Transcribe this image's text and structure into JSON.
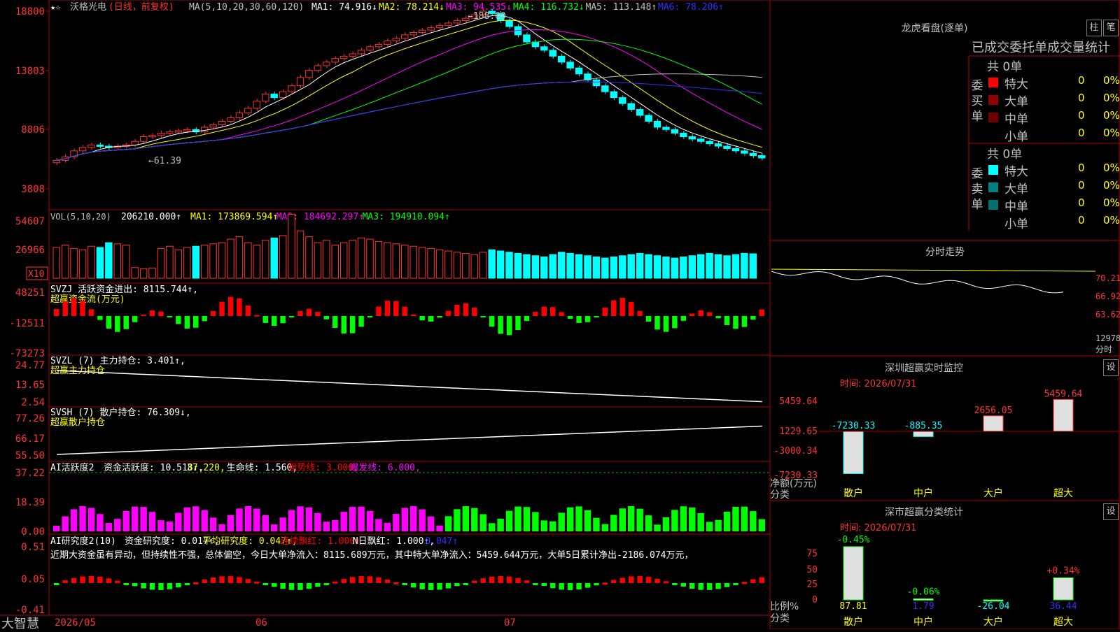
{
  "stock": {
    "name": "沃格光电",
    "period": "(日线，前复权)",
    "brand": "大智慧"
  },
  "colors": {
    "up": "#ff3232",
    "down": "#00ffff",
    "buy": "#ff0000",
    "sell": "#00ff00",
    "grid": "#b00000"
  },
  "price_panel": {
    "ma_header": "MA(5,10,20,30,60,120)",
    "ma_values": [
      {
        "label": "MA1: 74.916↓",
        "color": "#ffffff"
      },
      {
        "label": "MA2: 78.214↓",
        "color": "#ffff00"
      },
      {
        "label": "MA3: 94.535↓",
        "color": "#ff00ff"
      },
      {
        "label": "MA4: 116.732↓",
        "color": "#00ff00"
      },
      {
        "label": "MA5: 113.148↑",
        "color": "#c0c0c0"
      },
      {
        "label": "MA6: 78.206↑",
        "color": "#3030ff"
      }
    ],
    "yticks": [
      "18800",
      "13803",
      "8806",
      "3808"
    ],
    "high_label": "188.00",
    "low_label": "61.39"
  },
  "volume_panel": {
    "header": "VOL(5,10,20)",
    "value": "206210.000↑",
    "ma": [
      {
        "label": "MA1: 173869.594↑",
        "color": "#ffff00"
      },
      {
        "label": "MA2: 184692.297↑",
        "color": "#ff00ff"
      },
      {
        "label": "MA3: 194910.094↑",
        "color": "#00ff00"
      }
    ],
    "yticks": [
      "54607",
      "26966"
    ],
    "unit": "X10"
  },
  "svzj_panel": {
    "header": "SVZJ",
    "label": "活跃资金进出: 8115.744↑,",
    "sub": "超赢资金流(万元)",
    "yticks": [
      "48251",
      "-12511",
      "-73273"
    ]
  },
  "svzl_panel": {
    "header": "SVZL (7)",
    "label": "主力持仓: 3.401↑,",
    "sub": "超赢主力持仓",
    "yticks": [
      "24.77",
      "13.65",
      "2.54"
    ]
  },
  "svsh_panel": {
    "header": "SVSH (7)",
    "label": "散户持仓: 76.309↓,",
    "sub": "超赢散户持仓",
    "yticks": [
      "77.26",
      "66.17",
      "55.50"
    ]
  },
  "ai_active_panel": {
    "header": "AI活跃度2",
    "items": [
      {
        "label": "资金活跃度: 10.518↑,",
        "color": "#ffffff"
      },
      {
        "label": "37.220,",
        "color": "#ffff00"
      },
      {
        "label": "生命线: 1.560,",
        "color": "#ffffff"
      },
      {
        "label": "强势线: 3.000,",
        "color": "#ff0000"
      },
      {
        "label": "爆发线: 6.000,",
        "color": "#ff00ff"
      }
    ],
    "yticks": [
      "37.22",
      "18.39",
      "0.00"
    ]
  },
  "ai_research_panel": {
    "header": "AI研究度2(10)",
    "items": [
      {
        "label": "资金研究度: 0.017↑,",
        "color": "#ffffff"
      },
      {
        "label": "平均研究度: 0.047↑,",
        "color": "#ffff00"
      },
      {
        "label": "连续飘红: 1.000↑,",
        "color": "#ff0000"
      },
      {
        "label": "N日飘红: 1.000↑,",
        "color": "#ffffff"
      },
      {
        "label": "0.047↑",
        "color": "#3030ff"
      }
    ],
    "comment": "近期大资金虽有异动，但持续性不强，总体偏空，今日大单净流入：8115.689万元，其中特大单净流入：5459.644万元，大单5日累计净出-2186.074万元，",
    "yticks": [
      "0.51",
      "0.05",
      "-0.41"
    ]
  },
  "date_axis": {
    "labels": [
      "2026/05",
      "06",
      "07"
    ]
  },
  "longhu": {
    "title": "龙虎看盘(逐单)",
    "tab1": "柱",
    "tab2": "笔",
    "subtitle": "已成交委托单成交量统计",
    "buy_label": "委买单",
    "sell_label": "委卖单",
    "buy_total": "共 0单",
    "sell_total": "共 0单",
    "buy_rows": [
      {
        "name": "特大",
        "count": "0",
        "pct": "0%",
        "color": "#ff0000"
      },
      {
        "name": "大单",
        "count": "0",
        "pct": "0%",
        "color": "#900000"
      },
      {
        "name": "中单",
        "count": "0",
        "pct": "0%",
        "color": "#700000"
      },
      {
        "name": "小单",
        "count": "0",
        "pct": "0%",
        "color": "#000000"
      }
    ],
    "sell_rows": [
      {
        "name": "特大",
        "count": "0",
        "pct": "0%",
        "color": "#00ffff"
      },
      {
        "name": "大单",
        "count": "0",
        "pct": "0%",
        "color": "#008080"
      },
      {
        "name": "中单",
        "count": "0",
        "pct": "0%",
        "color": "#007070"
      },
      {
        "name": "小单",
        "count": "0",
        "pct": "0%",
        "color": "#000000"
      }
    ]
  },
  "intraday": {
    "title": "分时走势",
    "yticks": [
      "70.21",
      "66.92",
      "63.62"
    ],
    "vol_label": "12978",
    "unit": "分时"
  },
  "monitor": {
    "title": "深圳超赢实时监控",
    "btn": "设",
    "time": "时间: 2026/07/31",
    "yticks": [
      "5459.64",
      "1229.65",
      "-3000.34",
      "-7230.33"
    ],
    "ylabel": "净额(万元)",
    "xlabel": "分类",
    "chart_data": {
      "type": "bar",
      "categories": [
        "散户",
        "中户",
        "大户",
        "超大"
      ],
      "values": [
        -7230.33,
        -885.35,
        2656.05,
        5459.64
      ],
      "value_labels": [
        "-7230.33",
        "-885.35",
        "2656.05",
        "5459.64"
      ],
      "ylim": [
        -7230.33,
        5459.64
      ]
    }
  },
  "classify": {
    "title": "深市超赢分类统计",
    "btn": "设",
    "time": "时间: 2026/07/31",
    "yticks": [
      "75",
      "50",
      "25",
      "0"
    ],
    "ylabel": "比例%",
    "xlabel": "分类",
    "chart_data": {
      "type": "bar",
      "categories": [
        "散户",
        "中户",
        "大户",
        "超大"
      ],
      "values": [
        87.81,
        1.79,
        -26.04,
        36.44
      ],
      "value_labels": [
        "87.81",
        "1.79",
        "-26.04",
        "36.44"
      ],
      "change_labels": [
        "-0.45%",
        "-0.06%",
        "",
        "+0.34%"
      ],
      "ylim": [
        0,
        90
      ]
    }
  },
  "chart_data": {
    "type": "bar",
    "title": "沃格光电(日线，前复权)",
    "series": [
      {
        "name": "收盘价",
        "values": [
          62,
          65,
          70,
          73,
          75,
          74,
          73,
          74,
          75,
          78,
          82,
          83,
          85,
          86,
          87,
          88,
          86,
          90,
          92,
          95,
          98,
          102,
          106,
          112,
          118,
          115,
          120,
          125,
          132,
          138,
          142,
          145,
          148,
          150,
          152,
          155,
          158,
          160,
          163,
          165,
          168,
          170,
          172,
          174,
          176,
          178,
          180,
          182,
          185,
          188,
          186,
          180,
          175,
          168,
          162,
          158,
          155,
          150,
          145,
          140,
          135,
          130,
          125,
          120,
          115,
          110,
          105,
          100,
          95,
          90,
          88,
          85,
          82,
          80,
          78,
          76,
          74,
          72,
          70,
          68,
          66,
          64
        ]
      },
      {
        "name": "成交量",
        "values": [
          26000,
          28000,
          25000,
          24000,
          27000,
          26000,
          30000,
          29000,
          28000,
          9000,
          8000,
          8500,
          25000,
          27000,
          24000,
          26000,
          27000,
          28000,
          29000,
          30000,
          33000,
          35000,
          30000,
          28000,
          32000,
          34000,
          36000,
          54000,
          40000,
          35000,
          30000,
          32000,
          28000,
          30000,
          32000,
          34000,
          33000,
          31000,
          30000,
          29000,
          28000,
          27000,
          26000,
          25000,
          24000,
          23000,
          22000,
          21000,
          20000,
          22000,
          24000,
          23000,
          22000,
          21000,
          20000,
          19000,
          18000,
          20000,
          22000,
          21000,
          20000,
          19000,
          18000,
          17000,
          18000,
          19000,
          20000,
          21000,
          20000,
          19000,
          18000,
          17000,
          18000,
          19000,
          20000,
          21000,
          20000,
          19000,
          20000,
          21000,
          20621
        ]
      }
    ]
  }
}
